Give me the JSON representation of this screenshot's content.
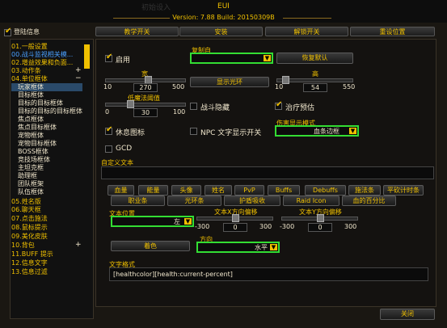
{
  "window": {
    "title": "EUI",
    "version_line": "Version: 7.88 Build: 20150309B",
    "ghost_text": "初始设入"
  },
  "top_tabs": {
    "login_label": "登陆信息",
    "tabs": [
      "教学开关",
      "安装",
      "解锁开关",
      "重设位置"
    ]
  },
  "sidebar": {
    "items": [
      {
        "label": "01.一般设置",
        "color": "#f0c000"
      },
      {
        "label": "00.战斗监视相关模...",
        "color": "#4aa0ff"
      },
      {
        "label": "02.增益效果和负面...",
        "color": "#f0c000"
      },
      {
        "label": "03.动作条",
        "color": "#f0c000",
        "toggle": "+"
      },
      {
        "label": "04.单位框体",
        "color": "#f0c000",
        "toggle": "−"
      }
    ],
    "subitems": [
      "玩家框体",
      "目标框体",
      "目标的目标框体",
      "目标的目标的目标框体",
      "焦点框体",
      "焦点目标框体",
      "宠物框体",
      "宠物目标框体",
      "BOSS框体",
      "竞技场框体",
      "主坦克框",
      "助理框",
      "团队框架",
      "队伍框体"
    ],
    "items2": [
      {
        "label": "05.姓名版",
        "color": "#f0c000"
      },
      {
        "label": "06.聊天框",
        "color": "#f0c000"
      },
      {
        "label": "07.点击施法",
        "color": "#f0c000"
      },
      {
        "label": "08.鼠标提示",
        "color": "#f0c000"
      },
      {
        "label": "09.美化皮肤",
        "color": "#f0c000"
      },
      {
        "label": "10.背包",
        "color": "#f0c000",
        "toggle": "+"
      },
      {
        "label": "11.BUFF 提示",
        "color": "#f0c000"
      },
      {
        "label": "12.信息文字",
        "color": "#f0c000"
      },
      {
        "label": "13.信息过滤",
        "color": "#f0c000"
      }
    ]
  },
  "main": {
    "enable_label": "启用",
    "copy_from_label": "复制自",
    "restore_default": "恢复默认",
    "width": {
      "label": "宽",
      "min": "10",
      "value": "270",
      "max": "500",
      "fraction": 0.52
    },
    "height": {
      "label": "高",
      "min": "10",
      "value": "54",
      "max": "550",
      "fraction": 0.08
    },
    "show_cursor": "显示光环",
    "low_mana": {
      "label": "低魔法阈值",
      "min": "0",
      "value": "30",
      "max": "100",
      "fraction": 0.3
    },
    "combat_hide": "战斗隐藏",
    "heal_predict": "治疗预估",
    "hurt_mode_label": "伤害显示模式",
    "hurt_mode_value": "血条边框",
    "rest_icon": "休息图标",
    "npc_text": "NPC 文字显示开关",
    "gcd": "GCD",
    "custom_text": "自定义文本",
    "tabs_row1": [
      "血量",
      "能量",
      "头像",
      "姓名",
      "PvP",
      "Buffs",
      "Debuffs",
      "施法条",
      "平砍计时条"
    ],
    "tabs_row2": [
      "职业条",
      "光环条",
      "护盾吸收",
      "Raid Icon",
      "血的百分比"
    ],
    "text_pos_label": "文本位置",
    "text_pos_value": "左",
    "x_offset": {
      "label": "文本X方向偏移",
      "min": "-300",
      "value": "0",
      "max": "300",
      "fraction": 0.5
    },
    "y_offset": {
      "label": "文本Y方向偏移",
      "min": "-300",
      "value": "0",
      "max": "300",
      "fraction": 0.5
    },
    "color_btn": "着色",
    "direction_label": "方向",
    "direction_value": "水平",
    "format_label": "文字格式",
    "format_value": "[healthcolor][health:current-percent]",
    "close": "关闭"
  }
}
